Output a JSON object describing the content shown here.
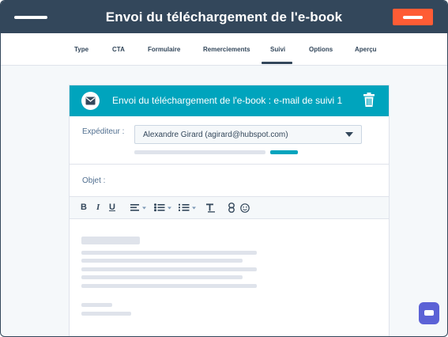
{
  "header": {
    "title": "Envoi du téléchargement de l'e-book",
    "menu_icon": "menu-icon"
  },
  "tabs": [
    {
      "label": "Type"
    },
    {
      "label": "CTA"
    },
    {
      "label": "Formulaire"
    },
    {
      "label": "Remerciements"
    },
    {
      "label": "Suivi",
      "active": true
    },
    {
      "label": "Options"
    },
    {
      "label": "Aperçu"
    }
  ],
  "card": {
    "title": "Envoi du téléchargement de l'e-book : e-mail de suivi 1",
    "icon": "mail-icon",
    "delete_icon": "trash-icon"
  },
  "sender": {
    "label": "Expéditeur :",
    "value": "Alexandre Girard (agirard@hubspot.com)"
  },
  "subject": {
    "label": "Objet :"
  },
  "toolbar": {
    "bold": "B",
    "italic": "I",
    "underline": "U"
  },
  "colors": {
    "topbar": "#33475b",
    "accent_orange": "#ff5c35",
    "teal": "#00a4bd",
    "chat": "#5c62d6"
  }
}
